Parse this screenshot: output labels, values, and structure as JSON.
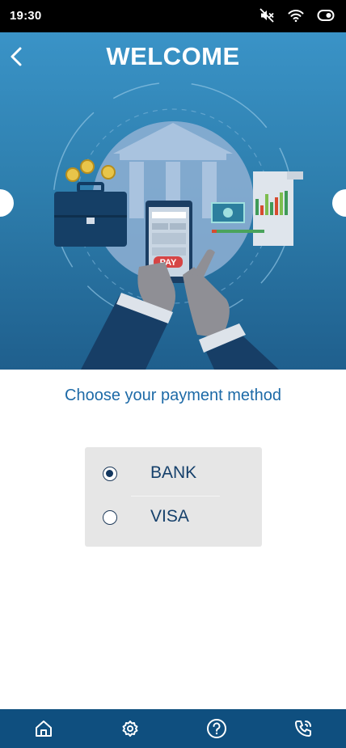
{
  "status_bar": {
    "time": "19:30",
    "icons": [
      "mute-icon",
      "wifi-icon",
      "toggle-icon"
    ]
  },
  "header": {
    "title": "WELCOME",
    "back_icon": "chevron-left-icon"
  },
  "illustration": {
    "pay_label": "PAY"
  },
  "payment": {
    "prompt": "Choose your payment method",
    "options": [
      {
        "label": "BANK",
        "selected": true
      },
      {
        "label": "VISA",
        "selected": false
      }
    ]
  },
  "bottom_nav": {
    "items": [
      "home-icon",
      "settings-icon",
      "help-icon",
      "phone-icon"
    ]
  },
  "colors": {
    "hero_top": "#3a93c7",
    "hero_bottom": "#1f5f8d",
    "prompt_text": "#1d6aa7",
    "nav_background": "#0f4f7f",
    "card_background": "#e6e6e6"
  }
}
